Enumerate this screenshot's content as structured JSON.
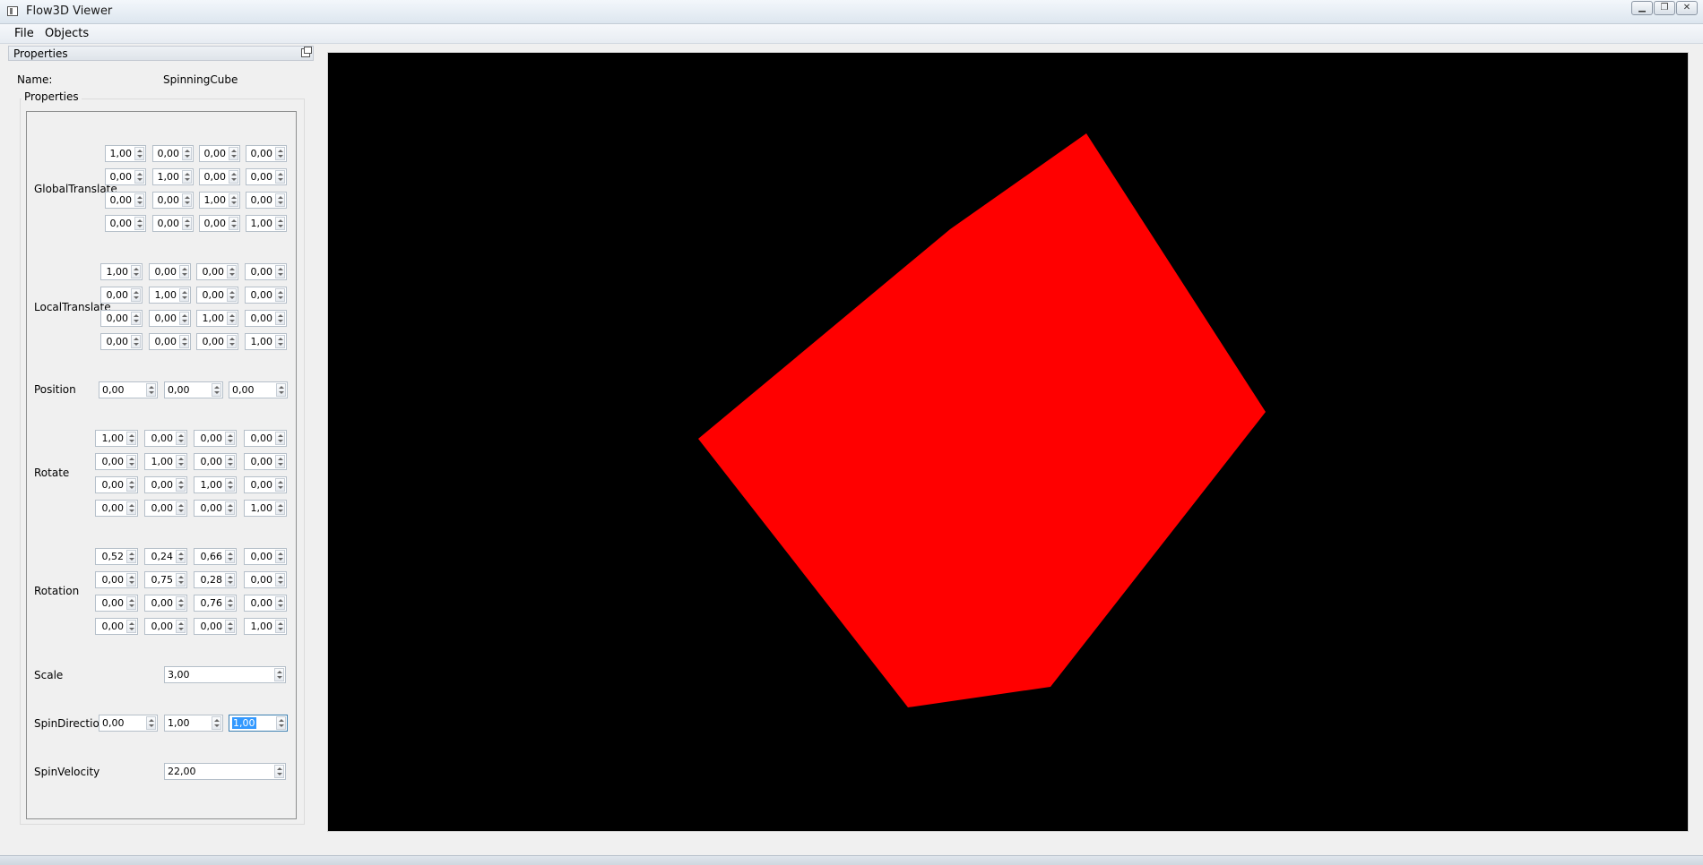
{
  "window": {
    "title": "Flow3D Viewer"
  },
  "menu": {
    "file": "File",
    "objects": "Objects"
  },
  "dock": {
    "title": "Properties"
  },
  "name_row": {
    "label": "Name:",
    "value": "SpinningCube"
  },
  "group": {
    "title": "Properties"
  },
  "fields": {
    "global_translate": {
      "label": "GlobalTranslate",
      "rows": [
        [
          "1,00",
          "0,00",
          "0,00",
          "0,00"
        ],
        [
          "0,00",
          "1,00",
          "0,00",
          "0,00"
        ],
        [
          "0,00",
          "0,00",
          "1,00",
          "0,00"
        ],
        [
          "0,00",
          "0,00",
          "0,00",
          "1,00"
        ]
      ]
    },
    "local_translate": {
      "label": "LocalTranslate",
      "rows": [
        [
          "1,00",
          "0,00",
          "0,00",
          "0,00"
        ],
        [
          "0,00",
          "1,00",
          "0,00",
          "0,00"
        ],
        [
          "0,00",
          "0,00",
          "1,00",
          "0,00"
        ],
        [
          "0,00",
          "0,00",
          "0,00",
          "1,00"
        ]
      ]
    },
    "position": {
      "label": "Position",
      "values": [
        "0,00",
        "0,00",
        "0,00"
      ]
    },
    "rotate": {
      "label": "Rotate",
      "rows": [
        [
          "1,00",
          "0,00",
          "0,00",
          "0,00"
        ],
        [
          "0,00",
          "1,00",
          "0,00",
          "0,00"
        ],
        [
          "0,00",
          "0,00",
          "1,00",
          "0,00"
        ],
        [
          "0,00",
          "0,00",
          "0,00",
          "1,00"
        ]
      ]
    },
    "rotation": {
      "label": "Rotation",
      "rows": [
        [
          "0,52",
          "0,24",
          "0,66",
          "0,00"
        ],
        [
          "0,00",
          "0,75",
          "0,28",
          "0,00"
        ],
        [
          "0,00",
          "0,00",
          "0,76",
          "0,00"
        ],
        [
          "0,00",
          "0,00",
          "0,00",
          "1,00"
        ]
      ]
    },
    "scale": {
      "label": "Scale",
      "value": "3,00"
    },
    "spin_direction": {
      "label": "SpinDirection",
      "values": [
        "0,00",
        "1,00",
        "1,00"
      ]
    },
    "spin_velocity": {
      "label": "SpinVelocity",
      "value": "22,00"
    }
  },
  "viewport": {
    "background": "#000000",
    "object_color": "#ff0000"
  }
}
